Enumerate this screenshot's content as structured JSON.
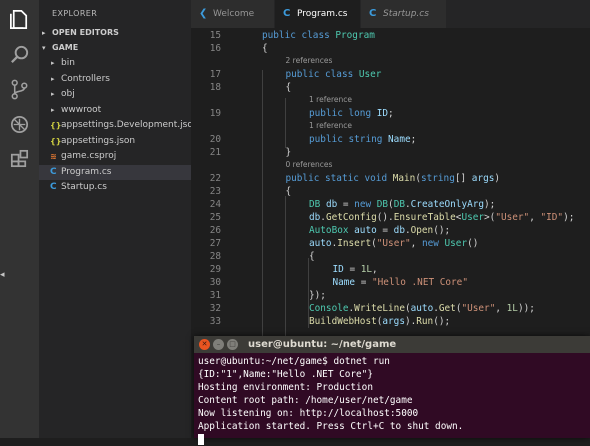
{
  "sidebar": {
    "title": "EXPLORER",
    "open_editors_label": "OPEN EDITORS",
    "project_label": "GAME",
    "items": [
      {
        "name": "bin",
        "kind": "folder"
      },
      {
        "name": "Controllers",
        "kind": "folder"
      },
      {
        "name": "obj",
        "kind": "folder"
      },
      {
        "name": "wwwroot",
        "kind": "folder"
      },
      {
        "name": "appsettings.Development.json",
        "kind": "json"
      },
      {
        "name": "appsettings.json",
        "kind": "json"
      },
      {
        "name": "game.csproj",
        "kind": "rss"
      },
      {
        "name": "Program.cs",
        "kind": "cs",
        "selected": true
      },
      {
        "name": "Startup.cs",
        "kind": "cs"
      }
    ]
  },
  "tabs": [
    {
      "label": "Welcome",
      "icon": "vscode-logo-icon",
      "active": false
    },
    {
      "label": "Program.cs",
      "icon": "csharp-icon",
      "active": true
    },
    {
      "label": "Startup.cs",
      "icon": "csharp-icon",
      "active": false,
      "preview": true
    }
  ],
  "editor": {
    "lines": [
      {
        "n": "15",
        "tokens": [
          [
            "kw",
            "public class "
          ],
          [
            "ty",
            "Program"
          ]
        ],
        "indent": 0
      },
      {
        "n": "16",
        "tokens": [
          [
            "pl",
            "{"
          ]
        ],
        "indent": 0
      },
      {
        "lens": "2 references",
        "indent": 1
      },
      {
        "n": "17",
        "tokens": [
          [
            "kw",
            "public class "
          ],
          [
            "ty",
            "User"
          ]
        ],
        "indent": 1
      },
      {
        "n": "18",
        "tokens": [
          [
            "pl",
            "{"
          ]
        ],
        "indent": 1
      },
      {
        "lens": "1 reference",
        "indent": 2
      },
      {
        "n": "19",
        "tokens": [
          [
            "kw",
            "public long "
          ],
          [
            "va",
            "ID"
          ],
          [
            "pl",
            ";"
          ]
        ],
        "indent": 2
      },
      {
        "lens": "1 reference",
        "indent": 2
      },
      {
        "n": "20",
        "tokens": [
          [
            "kw",
            "public string "
          ],
          [
            "va",
            "Name"
          ],
          [
            "pl",
            ";"
          ]
        ],
        "indent": 2
      },
      {
        "n": "21",
        "tokens": [
          [
            "pl",
            "}"
          ]
        ],
        "indent": 1
      },
      {
        "lens": "0 references",
        "indent": 1
      },
      {
        "n": "22",
        "tokens": [
          [
            "kw",
            "public static void "
          ],
          [
            "fn",
            "Main"
          ],
          [
            "pl",
            "("
          ],
          [
            "kw",
            "string"
          ],
          [
            "pl",
            "[] "
          ],
          [
            "va",
            "args"
          ],
          [
            "pl",
            ")"
          ]
        ],
        "indent": 1
      },
      {
        "n": "23",
        "tokens": [
          [
            "pl",
            "{"
          ]
        ],
        "indent": 1
      },
      {
        "n": "24",
        "tokens": [
          [
            "ty",
            "DB "
          ],
          [
            "va",
            "db"
          ],
          [
            "pl",
            " = "
          ],
          [
            "kw",
            "new "
          ],
          [
            "ty",
            "DB"
          ],
          [
            "pl",
            "("
          ],
          [
            "ty",
            "DB"
          ],
          [
            "pl",
            "."
          ],
          [
            "va",
            "CreateOnlyArg"
          ],
          [
            "pl",
            ");"
          ]
        ],
        "indent": 2
      },
      {
        "n": "25",
        "tokens": [
          [
            "va",
            "db"
          ],
          [
            "pl",
            "."
          ],
          [
            "fn",
            "GetConfig"
          ],
          [
            "pl",
            "()."
          ],
          [
            "fn",
            "EnsureTable"
          ],
          [
            "pl",
            "<"
          ],
          [
            "ty",
            "User"
          ],
          [
            "pl",
            ">("
          ],
          [
            "st",
            "\"User\""
          ],
          [
            "pl",
            ", "
          ],
          [
            "st",
            "\"ID\""
          ],
          [
            "pl",
            ");"
          ]
        ],
        "indent": 2
      },
      {
        "n": "26",
        "tokens": [
          [
            "ty",
            "AutoBox "
          ],
          [
            "va",
            "auto"
          ],
          [
            "pl",
            " = "
          ],
          [
            "va",
            "db"
          ],
          [
            "pl",
            "."
          ],
          [
            "fn",
            "Open"
          ],
          [
            "pl",
            "();"
          ]
        ],
        "indent": 2
      },
      {
        "n": "27",
        "tokens": [
          [
            "va",
            "auto"
          ],
          [
            "pl",
            "."
          ],
          [
            "fn",
            "Insert"
          ],
          [
            "pl",
            "("
          ],
          [
            "st",
            "\"User\""
          ],
          [
            "pl",
            ", "
          ],
          [
            "kw",
            "new "
          ],
          [
            "ty",
            "User"
          ],
          [
            "pl",
            "()"
          ]
        ],
        "indent": 2
      },
      {
        "n": "28",
        "tokens": [
          [
            "pl",
            "{"
          ]
        ],
        "indent": 2
      },
      {
        "n": "29",
        "tokens": [
          [
            "va",
            "ID"
          ],
          [
            "pl",
            " = "
          ],
          [
            "nu",
            "1L"
          ],
          [
            "pl",
            ","
          ]
        ],
        "indent": 3
      },
      {
        "n": "30",
        "tokens": [
          [
            "va",
            "Name"
          ],
          [
            "pl",
            " = "
          ],
          [
            "st",
            "\"Hello .NET Core\""
          ]
        ],
        "indent": 3
      },
      {
        "n": "31",
        "tokens": [
          [
            "pl",
            "});"
          ]
        ],
        "indent": 2
      },
      {
        "n": "32",
        "tokens": [
          [
            "ty",
            "Console"
          ],
          [
            "pl",
            "."
          ],
          [
            "fn",
            "WriteLine"
          ],
          [
            "pl",
            "("
          ],
          [
            "va",
            "auto"
          ],
          [
            "pl",
            "."
          ],
          [
            "fn",
            "Get"
          ],
          [
            "pl",
            "("
          ],
          [
            "st",
            "\"User\""
          ],
          [
            "pl",
            ", "
          ],
          [
            "nu",
            "1L"
          ],
          [
            "pl",
            "));"
          ]
        ],
        "indent": 2
      },
      {
        "n": "33",
        "tokens": [
          [
            "fn",
            "BuildWebHost"
          ],
          [
            "pl",
            "("
          ],
          [
            "va",
            "args"
          ],
          [
            "pl",
            ")."
          ],
          [
            "fn",
            "Run"
          ],
          [
            "pl",
            "();"
          ]
        ],
        "indent": 2
      }
    ]
  },
  "terminal": {
    "title": "user@ubuntu: ~/net/game",
    "lines": [
      "user@ubuntu:~/net/game$ dotnet run",
      "{ID:\"1\",Name:\"Hello .NET Core\"}",
      "Hosting environment: Production",
      "Content root path: /home/user/net/game",
      "Now listening on: http://localhost:5000",
      "Application started. Press Ctrl+C to shut down."
    ]
  },
  "colors": {
    "activity_bar": "#333333",
    "sidebar": "#252526",
    "editor_bg": "#1e1e1e",
    "terminal_bg": "#300a24",
    "close_button": "#e95420",
    "accent_blue": "#3c9bdc"
  }
}
